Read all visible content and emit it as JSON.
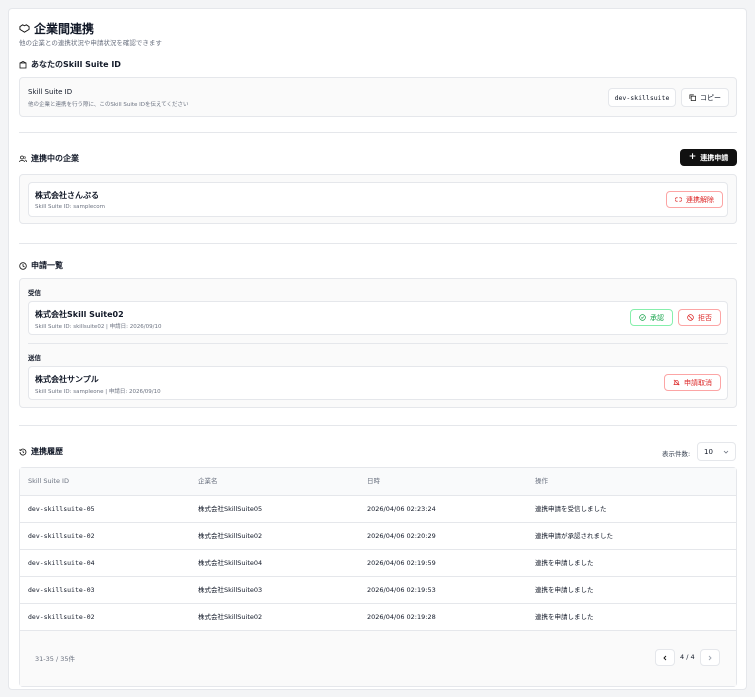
{
  "header": {
    "title": "企業間連携",
    "subtitle": "他の企業との連携状況や申請状況を確認できます"
  },
  "my_id": {
    "section_title": "あなたのSkill Suite ID",
    "label": "Skill Suite ID",
    "help": "他の企業と連携を行う際に、このSkill Suite IDを伝えてください",
    "value": "dev-skillsuite",
    "copy_label": "コピー"
  },
  "connected": {
    "section_title": "連携中の企業",
    "apply_label": "連携申請",
    "items": [
      {
        "name": "株式会社さんぷる",
        "meta": "Skill Suite ID: samplecom",
        "action": "連携解除"
      }
    ]
  },
  "requests": {
    "section_title": "申請一覧",
    "received_label": "受信",
    "received": [
      {
        "name": "株式会社Skill Suite02",
        "meta": "Skill Suite ID: skillsuite02 | 申請日: 2026/09/10",
        "approve": "承認",
        "reject": "拒否"
      }
    ],
    "sent_label": "送信",
    "sent": [
      {
        "name": "株式会社サンプル",
        "meta": "Skill Suite ID: sampleone | 申請日: 2026/09/10",
        "cancel": "申請取消"
      }
    ]
  },
  "history": {
    "section_title": "連携履歴",
    "per_page_label": "表示件数:",
    "per_page_value": "10",
    "columns": [
      "Skill Suite ID",
      "企業名",
      "日時",
      "操作"
    ],
    "rows": [
      [
        "dev-skillsuite-05",
        "株式会社SkillSuite05",
        "2026/04/06 02:23:24",
        "連携申請を受信しました"
      ],
      [
        "dev-skillsuite-02",
        "株式会社SkillSuite02",
        "2026/04/06 02:20:29",
        "連携申請が承認されました"
      ],
      [
        "dev-skillsuite-04",
        "株式会社SkillSuite04",
        "2026/04/06 02:19:59",
        "連携を申請しました"
      ],
      [
        "dev-skillsuite-03",
        "株式会社SkillSuite03",
        "2026/04/06 02:19:53",
        "連携を申請しました"
      ],
      [
        "dev-skillsuite-02",
        "株式会社SkillSuite02",
        "2026/04/06 02:19:28",
        "連携を申請しました"
      ]
    ],
    "count_text": "31-35 / 35件",
    "page_text": "4 / 4"
  }
}
